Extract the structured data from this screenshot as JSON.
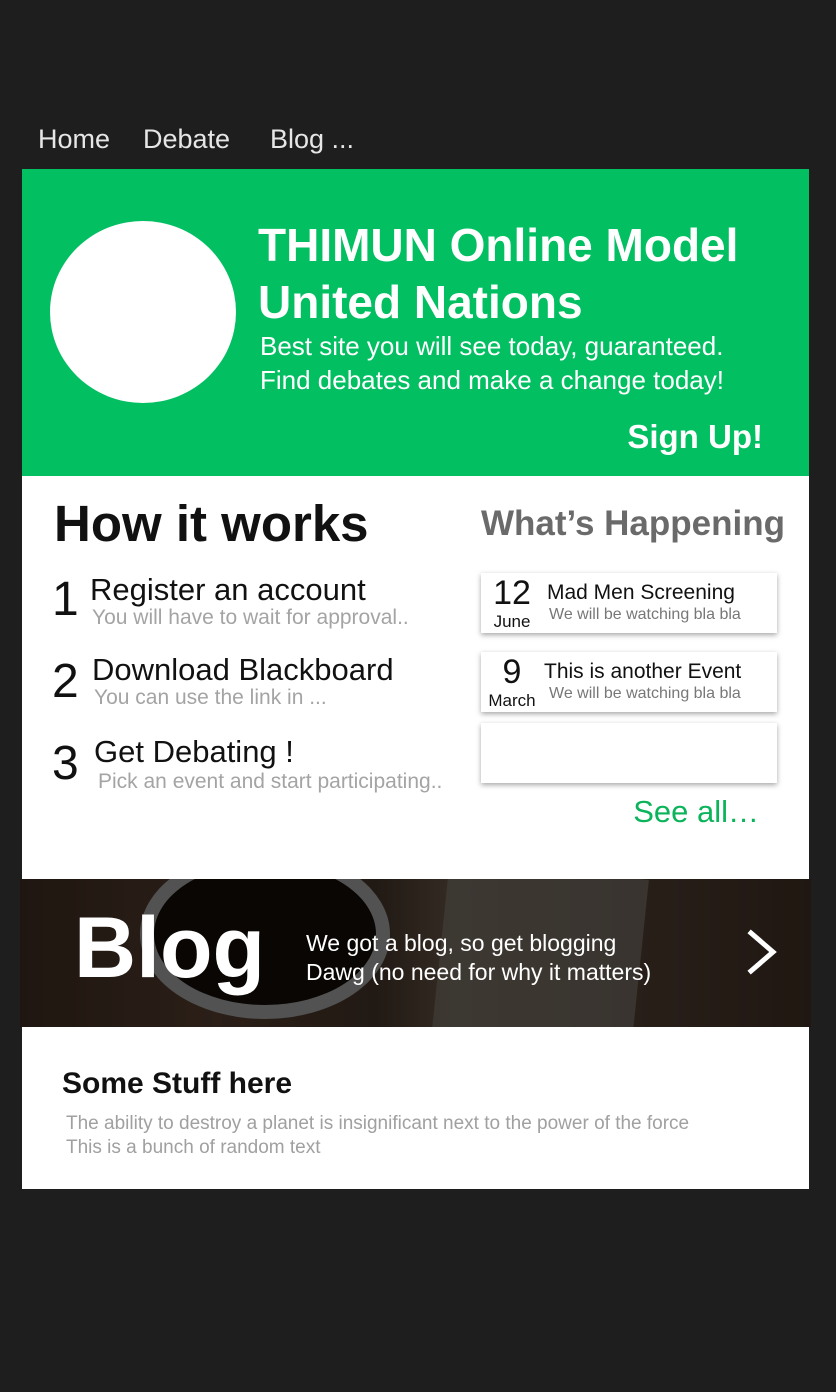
{
  "nav": {
    "items": [
      "Home",
      "Debate",
      "Blog ..."
    ]
  },
  "hero": {
    "title": "THIMUN Online Model United Nations",
    "subtitle_line1": "Best site you will see today, guaranteed.",
    "subtitle_line2": "Find debates and make a change today!",
    "signup_label": "Sign Up!"
  },
  "how_it_works": {
    "title": "How it works",
    "steps": [
      {
        "number": "1",
        "title": "Register an account",
        "desc": "You will have to wait for approval.."
      },
      {
        "number": "2",
        "title": "Download Blackboard",
        "desc": "You can use the link in ..."
      },
      {
        "number": "3",
        "title": "Get Debating !",
        "desc": "Pick an event and start participating.."
      }
    ]
  },
  "happening": {
    "title": "What’s Happening",
    "events": [
      {
        "day": "12",
        "month": "June",
        "name": "Mad Men Screening",
        "desc": "We will be watching bla bla"
      },
      {
        "day": "9",
        "month": "March",
        "name": "This is another Event",
        "desc": "We will be watching bla bla"
      }
    ],
    "see_all_label": "See all…"
  },
  "blog": {
    "title": "Blog",
    "text_line1": "We got a blog, so get blogging",
    "text_line2": "Dawg (no need for why it matters)",
    "arrow_icon": "chevron-right-icon"
  },
  "stuff": {
    "title": "Some Stuff here",
    "text_line1": "The ability to destroy a planet is insignificant next to the power of the force",
    "text_line2": "This is a bunch of random text"
  },
  "colors": {
    "accent": "#02bf62",
    "background": "#1e1e1e"
  }
}
